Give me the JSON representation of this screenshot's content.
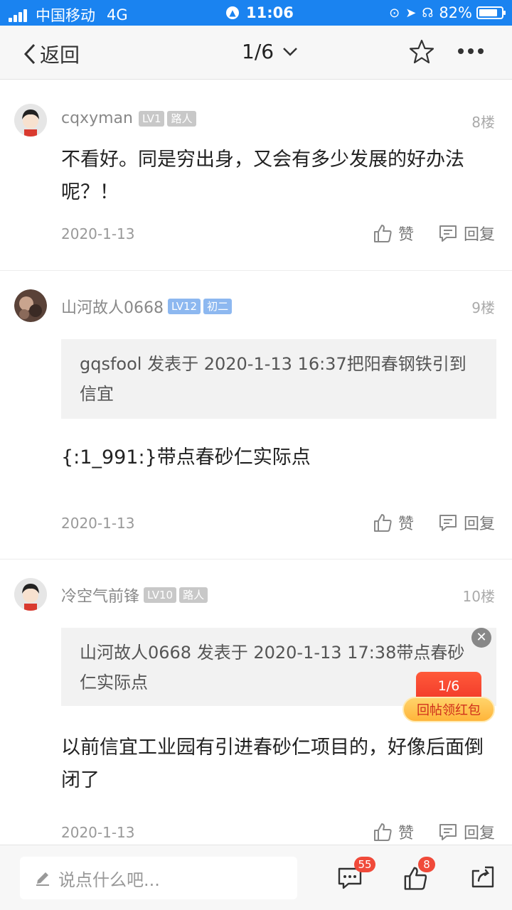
{
  "status_bar": {
    "carrier": "中国移动",
    "network": "4G",
    "time": "11:06",
    "battery": "82%",
    "battery_level": 0.82
  },
  "nav": {
    "back_label": "返回",
    "pager": "1/6"
  },
  "posts": [
    {
      "username": "cqxyman",
      "level": "LV1",
      "rank": "路人",
      "floor": "8楼",
      "content": "不看好。同是穷出身，又会有多少发展的好办法呢？！",
      "date": "2020-1-13",
      "like_label": "赞",
      "reply_label": "回复"
    },
    {
      "username": "山河故人0668",
      "level": "LV12",
      "rank": "初二",
      "floor": "9楼",
      "quote": "gqsfool 发表于 2020-1-13 16:37把阳春钢铁引到信宜",
      "content": "{:1_991:}带点春砂仁实际点",
      "date": "2020-1-13",
      "like_label": "赞",
      "reply_label": "回复"
    },
    {
      "username": "冷空气前锋",
      "level": "LV10",
      "rank": "路人",
      "floor": "10楼",
      "quote": "山河故人0668 发表于 2020-1-13 17:38带点春砂仁实际点",
      "content": "以前信宜工业园有引进春砂仁项目的，好像后面倒闭了",
      "date": "2020-1-13",
      "like_label": "赞",
      "reply_label": "回复"
    }
  ],
  "red_packet": {
    "page": "1/6",
    "label": "回帖领红包"
  },
  "bottom_bar": {
    "placeholder": "说点什么吧...",
    "comment_count": "55",
    "like_count": "8"
  }
}
